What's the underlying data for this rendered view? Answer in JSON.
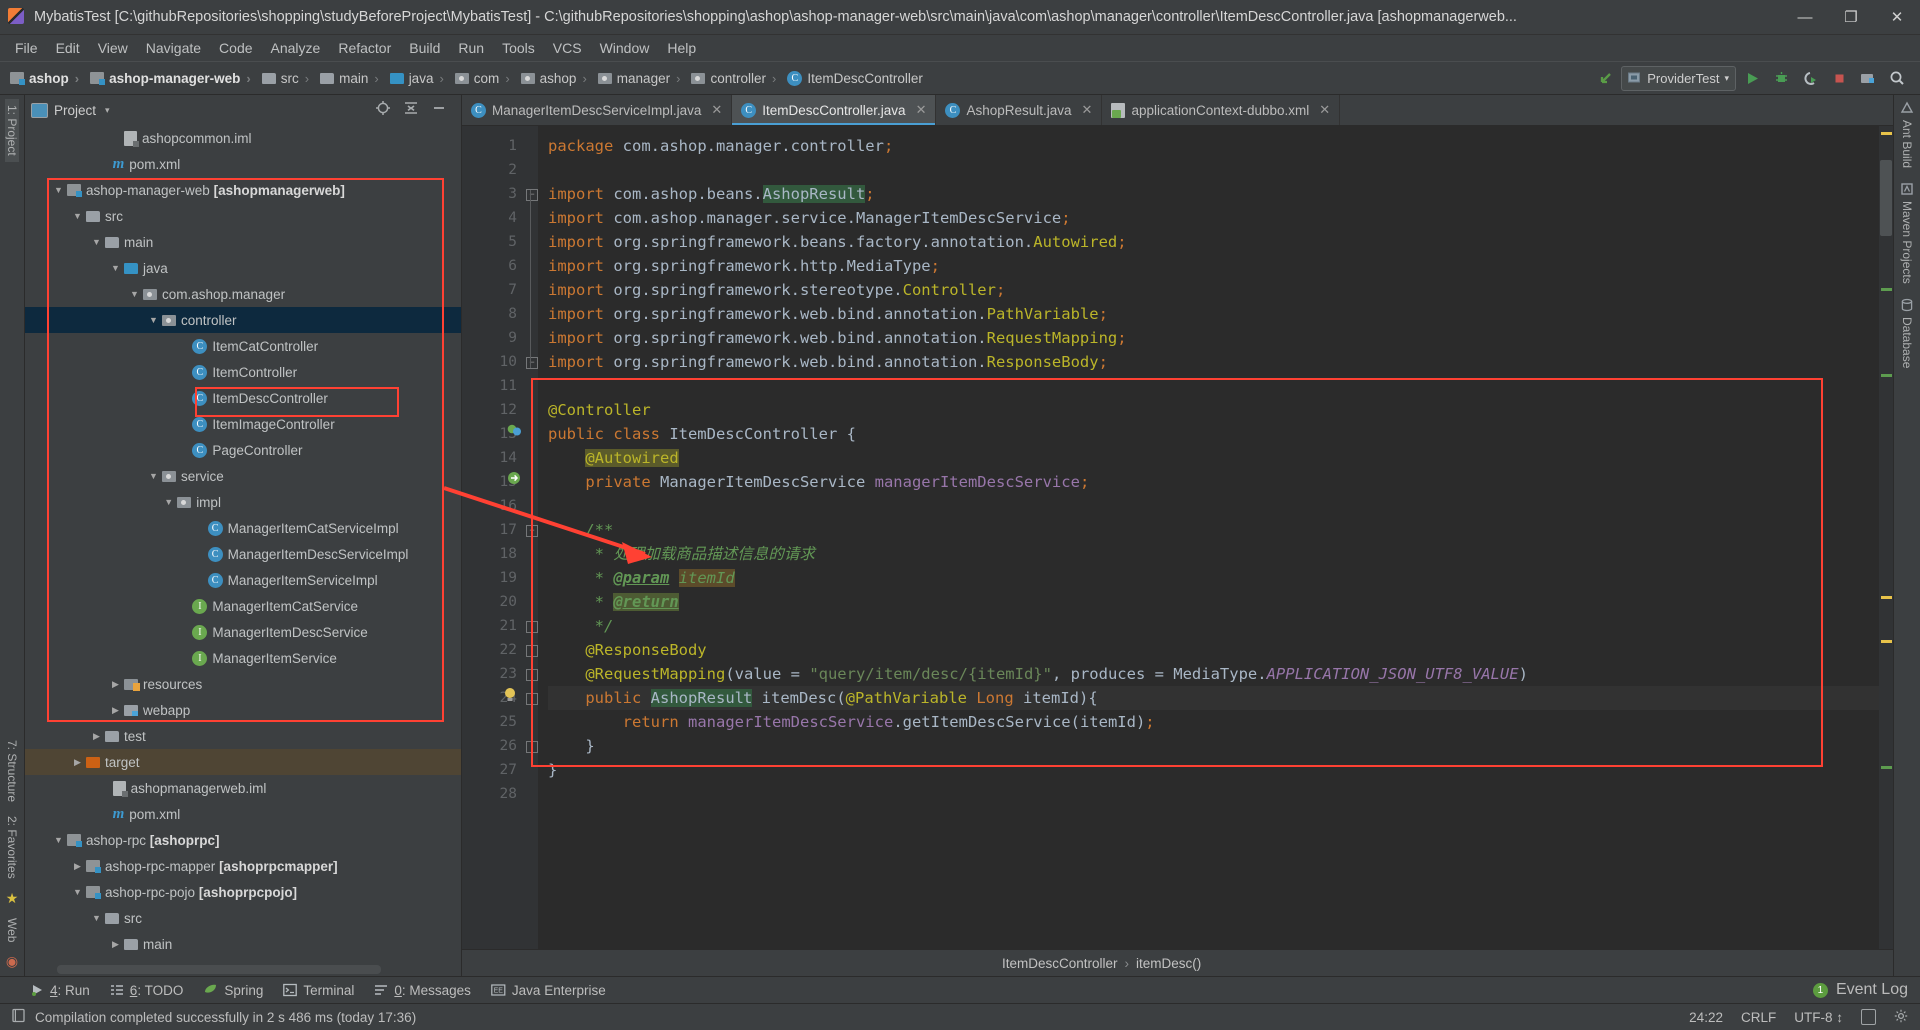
{
  "window": {
    "title": "MybatisTest [C:\\githubRepositories\\shopping\\studyBeforeProject\\MybatisTest] - C:\\githubRepositories\\shopping\\ashop\\ashop-manager-web\\src\\main\\java\\com\\ashop\\manager\\controller\\ItemDescController.java [ashopmanagerweb...",
    "app_icon": "intellij-idea-icon",
    "minimize": "—",
    "maximize": "❐",
    "close": "✕"
  },
  "menu": [
    {
      "label": "File"
    },
    {
      "label": "Edit"
    },
    {
      "label": "View"
    },
    {
      "label": "Navigate"
    },
    {
      "label": "Code"
    },
    {
      "label": "Analyze"
    },
    {
      "label": "Refactor"
    },
    {
      "label": "Build"
    },
    {
      "label": "Run"
    },
    {
      "label": "Tools"
    },
    {
      "label": "VCS"
    },
    {
      "label": "Window"
    },
    {
      "label": "Help"
    }
  ],
  "navbar": {
    "crumbs": [
      {
        "label": "ashop",
        "icon": "module-icon",
        "bold": true
      },
      {
        "label": "ashop-manager-web",
        "icon": "module-icon",
        "bold": true
      },
      {
        "label": "src",
        "icon": "folder-icon",
        "bold": false
      },
      {
        "label": "main",
        "icon": "folder-icon",
        "bold": false
      },
      {
        "label": "java",
        "icon": "source-folder-icon",
        "bold": false
      },
      {
        "label": "com",
        "icon": "package-icon",
        "bold": false
      },
      {
        "label": "ashop",
        "icon": "package-icon",
        "bold": false
      },
      {
        "label": "manager",
        "icon": "package-icon",
        "bold": false
      },
      {
        "label": "controller",
        "icon": "package-icon",
        "bold": false
      },
      {
        "label": "ItemDescController",
        "icon": "class-icon",
        "bold": false
      }
    ],
    "run_config": "ProviderTest",
    "run_config_caret": "▾",
    "buttons": [
      {
        "name": "build-icon",
        "glyph": "↖"
      },
      {
        "name": "run-icon",
        "glyph": "▶"
      },
      {
        "name": "debug-icon",
        "glyph": "⚙"
      },
      {
        "name": "run-coverage-icon",
        "glyph": "◔"
      },
      {
        "name": "stop-icon",
        "glyph": "■"
      },
      {
        "name": "open-settings-icon",
        "glyph": "☰"
      },
      {
        "name": "search-everywhere-icon",
        "glyph": "⌕"
      }
    ]
  },
  "left_rail": {
    "top": [
      "1: Project"
    ],
    "bottom": [
      "7: Structure",
      "2: Favorites",
      "Web"
    ]
  },
  "right_rail": [
    "Ant Build",
    "Maven Projects",
    "Database"
  ],
  "project_panel": {
    "title": "Project",
    "caret": "▾",
    "collapse_icon": "collapse-all-icon",
    "locate_icon": "locate-icon",
    "hide_icon": "hide-icon",
    "tree": [
      {
        "label": "ashopcommon.iml",
        "indent": 4,
        "arrow": "",
        "icon": "iml-icon",
        "state": "none"
      },
      {
        "label": "pom.xml",
        "indent": 3.4,
        "arrow": "",
        "icon": "maven-icon",
        "state": "none"
      },
      {
        "label": "ashop-manager-web ",
        "suffix": "[ashopmanagerweb]",
        "indent": 1,
        "arrow": "▼",
        "icon": "module-icon",
        "state": "none"
      },
      {
        "label": "src",
        "indent": 2,
        "arrow": "▼",
        "icon": "folder-icon",
        "state": "none"
      },
      {
        "label": "main",
        "indent": 3,
        "arrow": "▼",
        "icon": "folder-icon",
        "state": "none"
      },
      {
        "label": "java",
        "indent": 4,
        "arrow": "▼",
        "icon": "source-folder-icon",
        "state": "none"
      },
      {
        "label": "com.ashop.manager",
        "indent": 5,
        "arrow": "▼",
        "icon": "package-icon",
        "state": "none"
      },
      {
        "label": "controller",
        "indent": 6,
        "arrow": "▼",
        "icon": "package-icon",
        "state": "selected"
      },
      {
        "label": "ItemCatController",
        "indent": 7.6,
        "arrow": "",
        "icon": "class-icon",
        "state": "none"
      },
      {
        "label": "ItemController",
        "indent": 7.6,
        "arrow": "",
        "icon": "class-icon",
        "state": "none"
      },
      {
        "label": "ItemDescController",
        "indent": 7.6,
        "arrow": "",
        "icon": "class-icon",
        "state": "highlighted"
      },
      {
        "label": "ItemImageController",
        "indent": 7.6,
        "arrow": "",
        "icon": "class-icon",
        "state": "none"
      },
      {
        "label": "PageController",
        "indent": 7.6,
        "arrow": "",
        "icon": "class-icon",
        "state": "none"
      },
      {
        "label": "service",
        "indent": 6,
        "arrow": "▼",
        "icon": "package-icon",
        "state": "none"
      },
      {
        "label": "impl",
        "indent": 6.8,
        "arrow": "▼",
        "icon": "package-icon",
        "state": "none"
      },
      {
        "label": "ManagerItemCatServiceImpl",
        "indent": 8.4,
        "arrow": "",
        "icon": "class-icon",
        "state": "none"
      },
      {
        "label": "ManagerItemDescServiceImpl",
        "indent": 8.4,
        "arrow": "",
        "icon": "class-icon",
        "state": "none"
      },
      {
        "label": "ManagerItemServiceImpl",
        "indent": 8.4,
        "arrow": "",
        "icon": "class-icon",
        "state": "none"
      },
      {
        "label": "ManagerItemCatService",
        "indent": 7.6,
        "arrow": "",
        "icon": "interface-icon",
        "state": "none"
      },
      {
        "label": "ManagerItemDescService",
        "indent": 7.6,
        "arrow": "",
        "icon": "interface-icon",
        "state": "none"
      },
      {
        "label": "ManagerItemService",
        "indent": 7.6,
        "arrow": "",
        "icon": "interface-icon",
        "state": "none"
      },
      {
        "label": "resources",
        "indent": 4,
        "arrow": "▶",
        "icon": "resources-folder-icon",
        "state": "none"
      },
      {
        "label": "webapp",
        "indent": 4,
        "arrow": "▶",
        "icon": "webapp-folder-icon",
        "state": "none"
      },
      {
        "label": "test",
        "indent": 3,
        "arrow": "▶",
        "icon": "folder-icon",
        "state": "none"
      },
      {
        "label": "target",
        "indent": 2,
        "arrow": "▶",
        "icon": "target-folder-icon",
        "state": "target"
      },
      {
        "label": "ashopmanagerweb.iml",
        "indent": 3.4,
        "arrow": "",
        "icon": "iml-icon",
        "state": "none"
      },
      {
        "label": "pom.xml",
        "indent": 3.4,
        "arrow": "",
        "icon": "maven-icon",
        "state": "none"
      },
      {
        "label": "ashop-rpc ",
        "suffix": "[ashoprpc]",
        "indent": 1,
        "arrow": "▼",
        "icon": "module-icon",
        "state": "none"
      },
      {
        "label": "ashop-rpc-mapper ",
        "suffix": "[ashoprpcmapper]",
        "indent": 2,
        "arrow": "▶",
        "icon": "module-icon",
        "state": "none"
      },
      {
        "label": "ashop-rpc-pojo ",
        "suffix": "[ashoprpcpojo]",
        "indent": 2,
        "arrow": "▼",
        "icon": "module-icon",
        "state": "none"
      },
      {
        "label": "src",
        "indent": 3,
        "arrow": "▼",
        "icon": "folder-icon",
        "state": "none"
      },
      {
        "label": "main",
        "indent": 4,
        "arrow": "▶",
        "icon": "folder-icon",
        "state": "none"
      }
    ]
  },
  "editor": {
    "tabs": [
      {
        "label": "ManagerItemDescServiceImpl.java",
        "icon": "class-icon",
        "close": "✕",
        "active": false
      },
      {
        "label": "ItemDescController.java",
        "icon": "class-icon",
        "close": "✕",
        "active": true
      },
      {
        "label": "AshopResult.java",
        "icon": "class-icon",
        "close": "✕",
        "active": false
      },
      {
        "label": "applicationContext-dubbo.xml",
        "icon": "xml-spring-icon",
        "close": "✕",
        "active": false
      }
    ],
    "line_numbers": [
      1,
      2,
      3,
      4,
      5,
      6,
      7,
      8,
      9,
      10,
      11,
      12,
      13,
      14,
      15,
      16,
      17,
      18,
      19,
      20,
      21,
      22,
      23,
      24,
      25,
      26,
      27,
      28
    ],
    "breadcrumb": [
      "ItemDescController",
      "itemDesc()"
    ],
    "breadcrumb_sep": "›",
    "code_lines": [
      "package com.ashop.manager.controller;",
      "",
      "import com.ashop.beans.AshopResult;",
      "import com.ashop.manager.service.ManagerItemDescService;",
      "import org.springframework.beans.factory.annotation.Autowired;",
      "import org.springframework.http.MediaType;",
      "import org.springframework.stereotype.Controller;",
      "import org.springframework.web.bind.annotation.PathVariable;",
      "import org.springframework.web.bind.annotation.RequestMapping;",
      "import org.springframework.web.bind.annotation.ResponseBody;",
      "",
      "@Controller",
      "public class ItemDescController {",
      "    @Autowired",
      "    private ManagerItemDescService managerItemDescService;",
      "",
      "    /**",
      "     * 处理加载商品描述信息的请求",
      "     * @param itemId",
      "     * @return",
      "     */",
      "    @ResponseBody",
      "    @RequestMapping(value = \"query/item/desc/{itemId}\", produces = MediaType.APPLICATION_JSON_UTF8_VALUE)",
      "    public AshopResult itemDesc(@PathVariable Long itemId){",
      "        return managerItemDescService.getItemDescService(itemId);",
      "    }",
      "}",
      ""
    ]
  },
  "bottom_tool_windows": [
    {
      "num": "4",
      "label": ": Run",
      "icon": "run-icon"
    },
    {
      "num": "6",
      "label": ": TODO",
      "icon": "todo-icon"
    },
    {
      "num": "",
      "label": "Spring",
      "icon": "spring-leaf-icon"
    },
    {
      "num": "",
      "label": "Terminal",
      "icon": "terminal-icon"
    },
    {
      "num": "0",
      "label": ": Messages",
      "icon": "messages-icon"
    },
    {
      "num": "",
      "label": "Java Enterprise",
      "icon": "java-enterprise-icon"
    }
  ],
  "event_log": {
    "count": "1",
    "label": "Event Log"
  },
  "status_bar": {
    "message": "Compilation completed successfully in 2 s 486 ms (today 17:36)",
    "message_icon": "notification-icon",
    "caret_position": "24:22",
    "line_separator": "CRLF",
    "encoding": "UTF-8",
    "encoding_caret": "↕",
    "lock_icon": "read-only-icon",
    "settings_icon": "settings-icon"
  },
  "colors": {
    "accent": "#4a9fd4",
    "annotation_red": "#ff4133",
    "panel_bg": "#3c3f41",
    "editor_bg": "#2b2b2b",
    "selection_blue": "#0d293e",
    "target_brown": "#4f4534",
    "keyword_orange": "#cc7832",
    "string_green": "#6a8759",
    "comment_green": "#629755",
    "annotation_yellow": "#bbb529",
    "field_purple": "#9876aa"
  }
}
